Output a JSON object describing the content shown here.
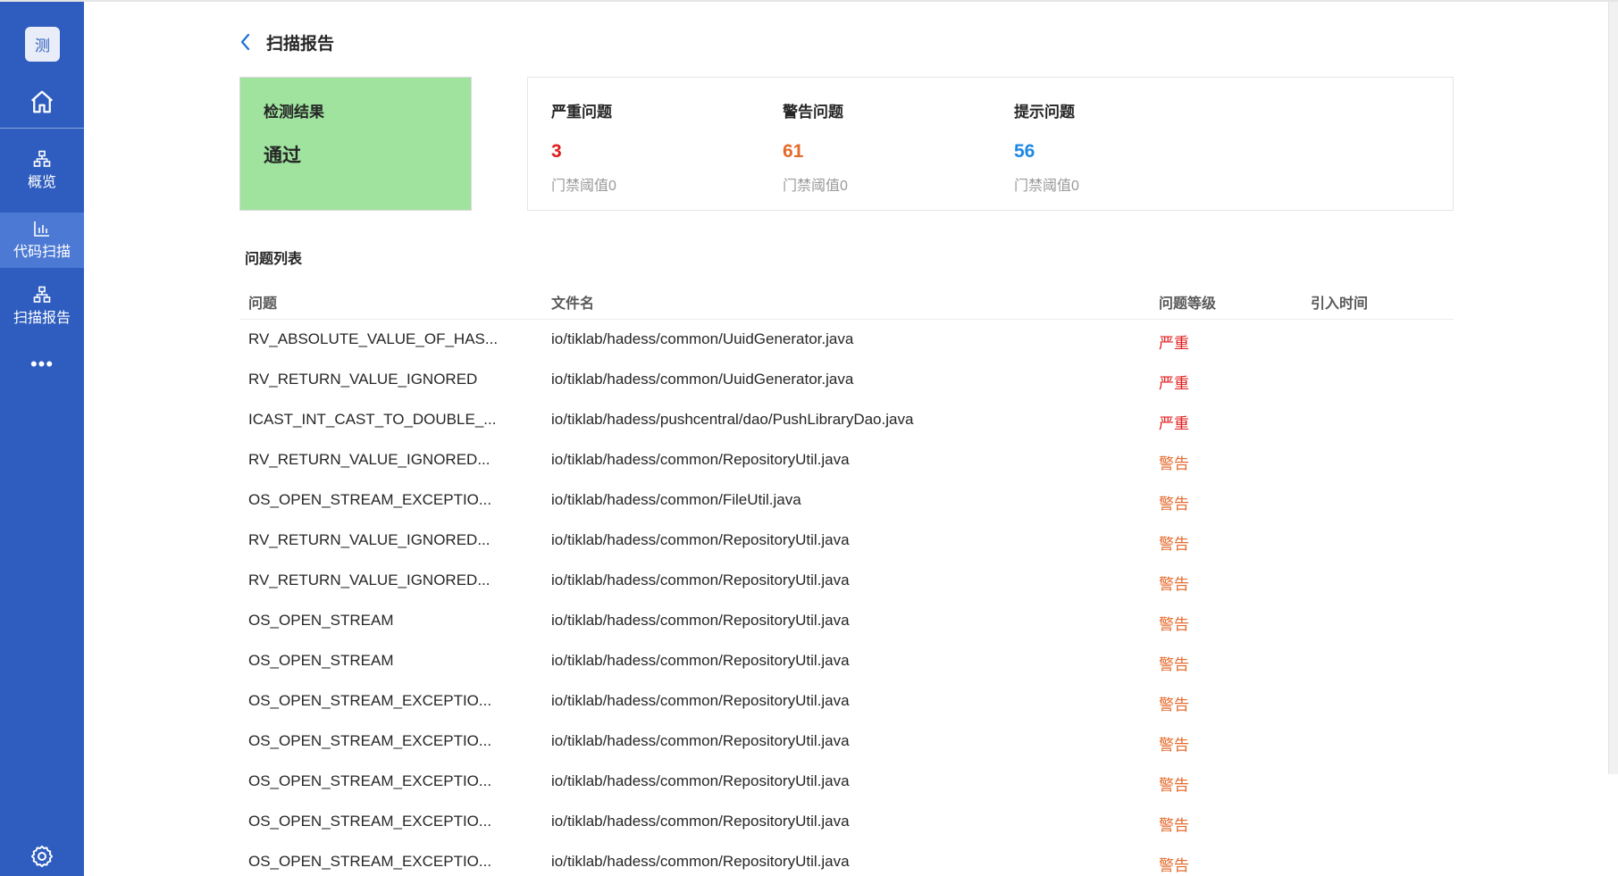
{
  "sidebar": {
    "logo_text": "测",
    "items": [
      {
        "label": "概览",
        "icon": "sitemap-icon"
      },
      {
        "label": "代码扫描",
        "icon": "bar-chart-icon",
        "active": true
      },
      {
        "label": "扫描报告",
        "icon": "sitemap-icon"
      }
    ],
    "more_label": "•••"
  },
  "header": {
    "title": "扫描报告"
  },
  "result": {
    "label": "检测结果",
    "value": "通过",
    "color": "#9fe39f"
  },
  "stats": [
    {
      "label": "严重问题",
      "value": "3",
      "threshold": "门禁阈值0",
      "color": "#e11c1c"
    },
    {
      "label": "警告问题",
      "value": "61",
      "threshold": "门禁阈值0",
      "color": "#e46a2b"
    },
    {
      "label": "提示问题",
      "value": "56",
      "threshold": "门禁阈值0",
      "color": "#1e88e5"
    }
  ],
  "issues": {
    "title": "问题列表",
    "columns": [
      "问题",
      "文件名",
      "问题等级",
      "引入时间"
    ],
    "rows": [
      {
        "issue": "RV_ABSOLUTE_VALUE_OF_HAS...",
        "file": "io/tiklab/hadess/common/UuidGenerator.java",
        "level": "严重",
        "time": ""
      },
      {
        "issue": "RV_RETURN_VALUE_IGNORED",
        "file": "io/tiklab/hadess/common/UuidGenerator.java",
        "level": "严重",
        "time": ""
      },
      {
        "issue": "ICAST_INT_CAST_TO_DOUBLE_...",
        "file": "io/tiklab/hadess/pushcentral/dao/PushLibraryDao.java",
        "level": "严重",
        "time": ""
      },
      {
        "issue": "RV_RETURN_VALUE_IGNORED...",
        "file": "io/tiklab/hadess/common/RepositoryUtil.java",
        "level": "警告",
        "time": ""
      },
      {
        "issue": "OS_OPEN_STREAM_EXCEPTIO...",
        "file": "io/tiklab/hadess/common/FileUtil.java",
        "level": "警告",
        "time": ""
      },
      {
        "issue": "RV_RETURN_VALUE_IGNORED...",
        "file": "io/tiklab/hadess/common/RepositoryUtil.java",
        "level": "警告",
        "time": ""
      },
      {
        "issue": "RV_RETURN_VALUE_IGNORED...",
        "file": "io/tiklab/hadess/common/RepositoryUtil.java",
        "level": "警告",
        "time": ""
      },
      {
        "issue": "OS_OPEN_STREAM",
        "file": "io/tiklab/hadess/common/RepositoryUtil.java",
        "level": "警告",
        "time": ""
      },
      {
        "issue": "OS_OPEN_STREAM",
        "file": "io/tiklab/hadess/common/RepositoryUtil.java",
        "level": "警告",
        "time": ""
      },
      {
        "issue": "OS_OPEN_STREAM_EXCEPTIO...",
        "file": "io/tiklab/hadess/common/RepositoryUtil.java",
        "level": "警告",
        "time": ""
      },
      {
        "issue": "OS_OPEN_STREAM_EXCEPTIO...",
        "file": "io/tiklab/hadess/common/RepositoryUtil.java",
        "level": "警告",
        "time": ""
      },
      {
        "issue": "OS_OPEN_STREAM_EXCEPTIO...",
        "file": "io/tiklab/hadess/common/RepositoryUtil.java",
        "level": "警告",
        "time": ""
      },
      {
        "issue": "OS_OPEN_STREAM_EXCEPTIO...",
        "file": "io/tiklab/hadess/common/RepositoryUtil.java",
        "level": "警告",
        "time": ""
      },
      {
        "issue": "OS_OPEN_STREAM_EXCEPTIO...",
        "file": "io/tiklab/hadess/common/RepositoryUtil.java",
        "level": "警告",
        "time": ""
      }
    ]
  },
  "colors": {
    "sidebar": "#2f5dbf",
    "sidebar_active": "#4c79d4",
    "severe": "#e11c1c",
    "warning": "#e46a2b",
    "hint": "#1e88e5"
  }
}
